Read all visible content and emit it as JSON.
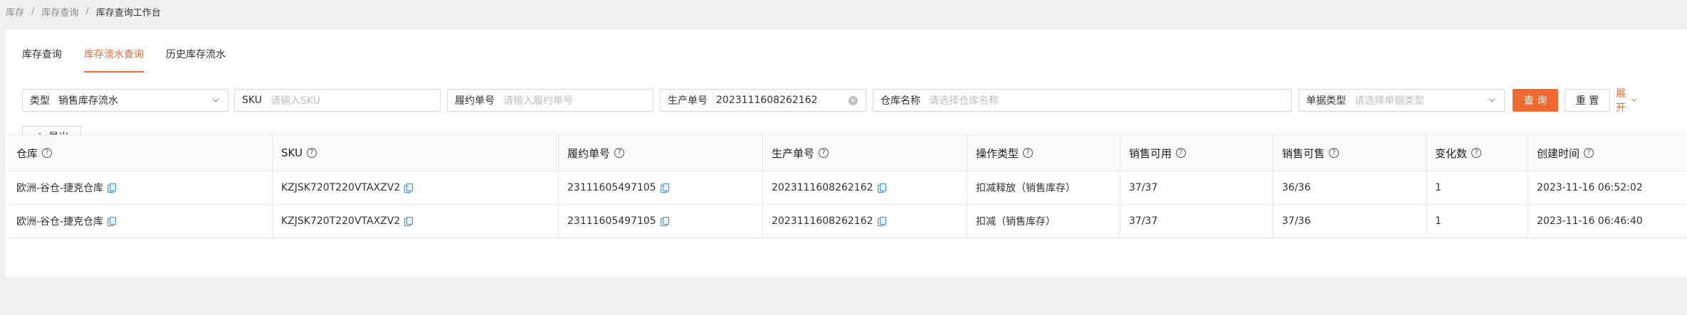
{
  "breadcrumb": {
    "items": [
      "库存",
      "库存查询",
      "库存查询工作台"
    ],
    "separator": "/"
  },
  "tabs": [
    {
      "label": "库存查询",
      "active": false
    },
    {
      "label": "库存流水查询",
      "active": true
    },
    {
      "label": "历史库存流水",
      "active": false
    }
  ],
  "filters": {
    "type": {
      "label": "类型",
      "value": "销售库存流水"
    },
    "sku": {
      "label": "SKU",
      "placeholder": "请输入SKU"
    },
    "fulfillment_no": {
      "label": "履约单号",
      "placeholder": "请输入履约单号"
    },
    "production_no": {
      "label": "生产单号",
      "value": "2023111608262162"
    },
    "warehouse_name": {
      "label": "仓库名称",
      "placeholder": "请选择仓库名称"
    },
    "doc_type": {
      "label": "单据类型",
      "placeholder": "请选择单据类型"
    },
    "query_button": "查 询",
    "reset_button": "重 置",
    "expand_label": "展开"
  },
  "export_button": "导出",
  "table": {
    "columns": [
      "仓库",
      "SKU",
      "履约单号",
      "生产单号",
      "操作类型",
      "销售可用",
      "销售可售",
      "变化数",
      "创建时间"
    ],
    "rows": [
      [
        "欧洲-谷仓-捷克仓库",
        "KZJSK720T220VTAXZV2",
        "23111605497105",
        "2023111608262162",
        "扣减释放（销售库存）",
        "37/37",
        "36/36",
        "1",
        "2023-11-16 06:52:02"
      ],
      [
        "欧洲-谷仓-捷克仓库",
        "KZJSK720T220VTAXZV2",
        "23111605497105",
        "2023111608262162",
        "扣减（销售库存）",
        "37/37",
        "37/36",
        "1",
        "2023-11-16 06:46:40"
      ]
    ]
  },
  "colors": {
    "accent": "#f06a30",
    "copy_icon": "#3b8ef0"
  }
}
